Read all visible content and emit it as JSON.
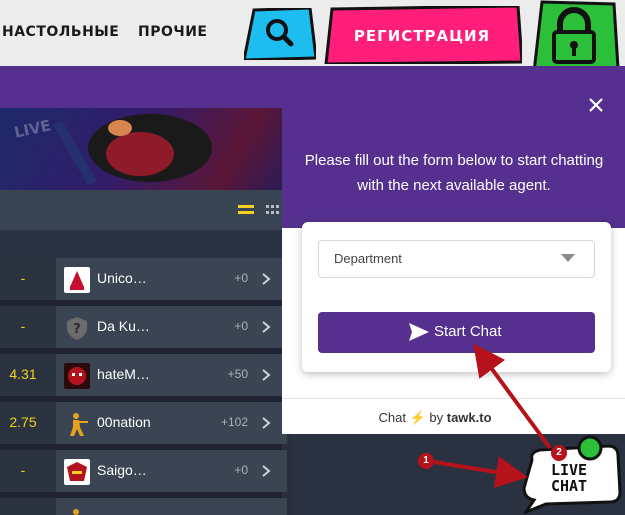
{
  "topnav": {
    "links": [
      "НАСТОЛЬНЫЕ",
      "ПРОЧИЕ"
    ],
    "search_icon": "search-icon",
    "register_label": "РЕГИСТРАЦИЯ",
    "lock_icon": "lock-icon",
    "colors": {
      "search_bg": "#1ebdf0",
      "register_bg": "#ff1f7a",
      "lock_bg": "#2bbf3a"
    }
  },
  "banner": {
    "text": "LIVE"
  },
  "matches": [
    {
      "score": "-",
      "team": "Unico…",
      "plus": "+0",
      "logo_color": "#c8102e"
    },
    {
      "score": "-",
      "team": "Da Ku…",
      "plus": "+0",
      "logo_color": "#6b6b6b"
    },
    {
      "score": "4.31",
      "team": "hateM…",
      "plus": "+50",
      "logo_color": "#b3121f"
    },
    {
      "score": "2.75",
      "team": "00nation",
      "plus": "+102",
      "logo_color": "#e6a21c"
    },
    {
      "score": "-",
      "team": "Saigo…",
      "plus": "+0",
      "logo_color": "#b3121f"
    }
  ],
  "chat": {
    "intro": "Please fill out the form below to start chatting with the next available agent.",
    "department_placeholder": "Department",
    "start_button": "Start Chat",
    "powered_prefix": "Chat",
    "powered_by": "by",
    "powered_brand": "tawk.to",
    "accent": "#55308f"
  },
  "launcher": {
    "line1": "LIVE",
    "line2": "CHAT",
    "bubble_color": "#ffffff",
    "dot_color": "#2bbf3a"
  },
  "annotations": {
    "badge1": "1",
    "badge2": "2",
    "arrow_color": "#b5121b"
  }
}
